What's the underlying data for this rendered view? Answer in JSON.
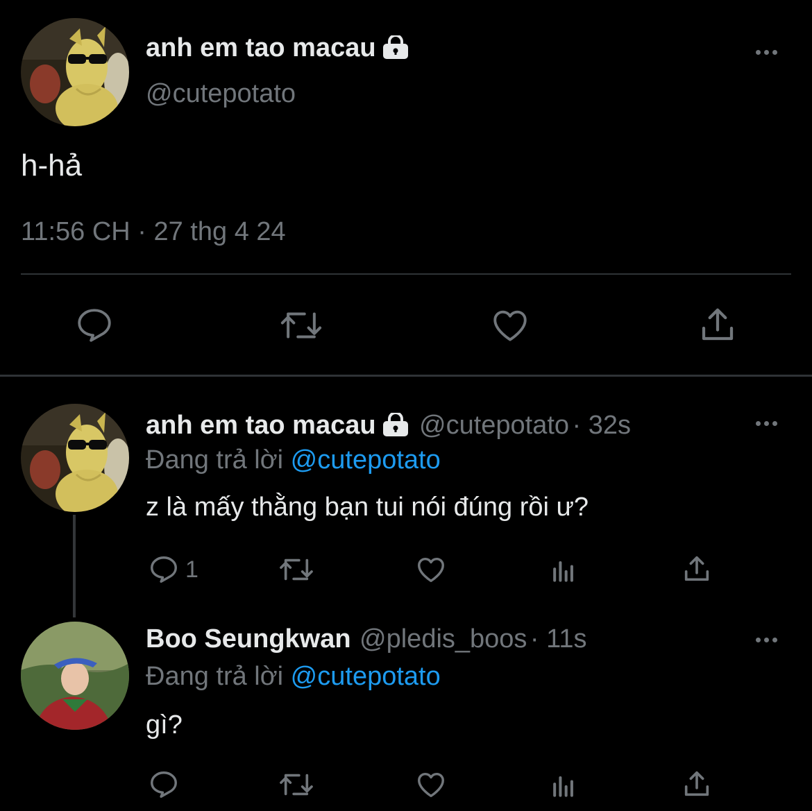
{
  "main_tweet": {
    "display_name": "anh em tao macau",
    "handle": "@cutepotato",
    "text": "h-hả",
    "timestamp": "11:56 CH · 27 thg 4 24",
    "locked_icon": "lock-icon",
    "actions": [
      "reply-icon",
      "retweet-icon",
      "like-icon",
      "share-icon"
    ]
  },
  "replies": [
    {
      "display_name": "anh em tao macau",
      "handle": "@cutepotato",
      "time": "· 32s",
      "replying_prefix": "Đang trả lời",
      "replying_to": "@cutepotato",
      "text": "z là mấy thằng bạn tui nói đúng rồi ư?",
      "reply_count": "1"
    },
    {
      "display_name": "Boo Seungkwan",
      "handle": "@pledis_boos",
      "time": "· 11s",
      "replying_prefix": "Đang trả lời",
      "replying_to": "@cutepotato",
      "text": "gì?",
      "reply_count": ""
    }
  ],
  "colors": {
    "background": "#000000",
    "text": "#e7e9ea",
    "muted": "#71767b",
    "link": "#1d9bf0",
    "divider": "#2f3336"
  }
}
